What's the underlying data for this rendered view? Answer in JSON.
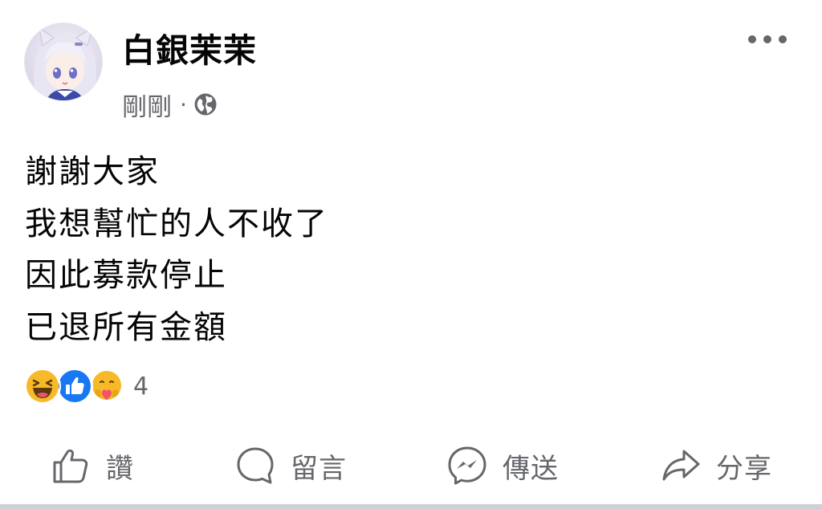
{
  "post": {
    "author": "白銀茉茉",
    "timestamp": "剛剛",
    "meta_separator": "·",
    "privacy_icon": "globe-icon",
    "body_lines": [
      "謝謝大家",
      "我想幫忙的人不收了",
      "因此募款停止",
      "已退所有金額"
    ],
    "reactions": {
      "icons": [
        "haha-reaction-icon",
        "like-reaction-icon",
        "care-reaction-icon"
      ],
      "count": "4"
    }
  },
  "actions": [
    {
      "icon": "like-icon",
      "label": "讚"
    },
    {
      "icon": "comment-icon",
      "label": "留言"
    },
    {
      "icon": "messenger-icon",
      "label": "傳送"
    },
    {
      "icon": "share-icon",
      "label": "分享"
    }
  ],
  "colors": {
    "text_primary": "#050505",
    "text_secondary": "#65676b",
    "like_blue": "#1877f2",
    "haha_yellow": "#f7b928"
  }
}
